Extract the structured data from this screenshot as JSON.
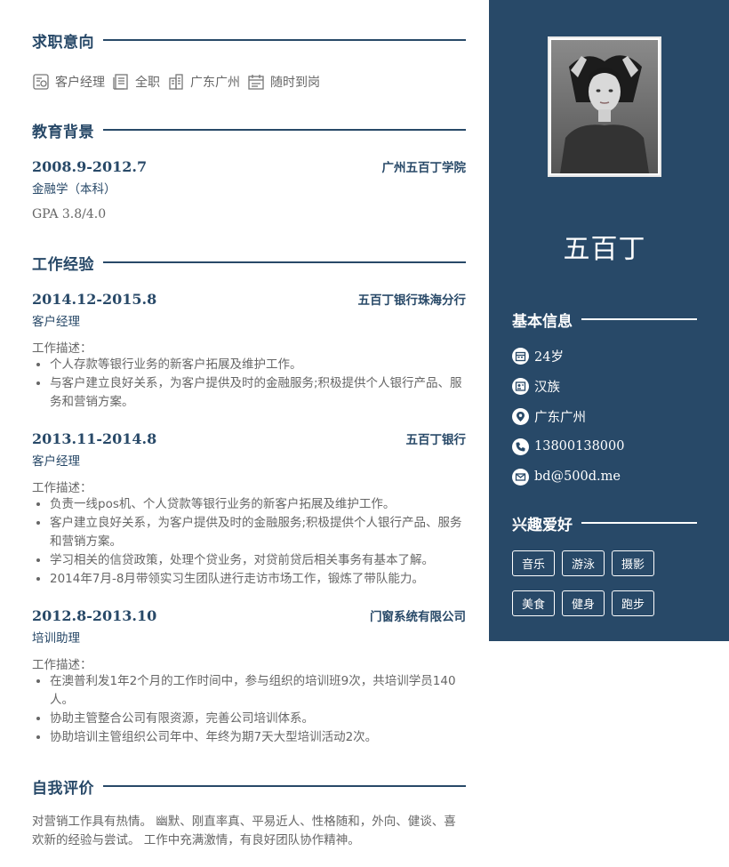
{
  "sections": {
    "intent": "求职意向",
    "education": "教育背景",
    "work": "工作经验",
    "self": "自我评价",
    "basic_info": "基本信息",
    "hobbies": "兴趣爱好"
  },
  "intent": {
    "position": "客户经理",
    "type": "全职",
    "city": "广东广州",
    "availability": "随时到岗"
  },
  "education": {
    "date": "2008.9-2012.7",
    "school": "广州五百丁学院",
    "major": "金融学（本科）",
    "gpa": "GPA 3.8/4.0"
  },
  "work": [
    {
      "date": "2014.12-2015.8",
      "company": "五百丁银行珠海分行",
      "role": "客户经理",
      "desc_label": "工作描述：",
      "bullets": [
        "个人存款等银行业务的新客户拓展及维护工作。",
        "与客户建立良好关系，为客户提供及时的金融服务;积极提供个人银行产品、服务和营销方案。"
      ]
    },
    {
      "date": "2013.11-2014.8",
      "company": "五百丁银行",
      "role": "客户经理",
      "desc_label": "工作描述：",
      "bullets": [
        "负责一线pos机、个人贷款等银行业务的新客户拓展及维护工作。",
        "客户建立良好关系，为客户提供及时的金融服务;积极提供个人银行产品、服务和营销方案。",
        "学习相关的信贷政策，处理个贷业务，对贷前贷后相关事务有基本了解。",
        "2014年7月-8月带领实习生团队进行走访市场工作，锻炼了带队能力。"
      ]
    },
    {
      "date": "2012.8-2013.10",
      "company": "门窗系统有限公司",
      "role": "培训助理",
      "desc_label": "工作描述：",
      "bullets": [
        "在澳普利发1年2个月的工作时间中，参与组织的培训班9次，共培训学员140人。",
        "协助主管整合公司有限资源，完善公司培训体系。",
        "协助培训主管组织公司年中、年终为期7天大型培训活动2次。"
      ]
    }
  ],
  "self_evaluation": "对营销工作具有热情。 幽默、刚直率真、平易近人、性格随和，外向、健谈、喜欢新的经验与尝试。 工作中充满激情，有良好团队协作精神。",
  "profile": {
    "name": "五百丁",
    "age": "24岁",
    "ethnicity": "汉族",
    "location": "广东广州",
    "phone": "13800138000",
    "email": "bd@500d.me"
  },
  "hobbies": [
    "音乐",
    "游泳",
    "摄影",
    "美食",
    "健身",
    "跑步"
  ],
  "colors": {
    "primary": "#284968",
    "text": "#666666",
    "white": "#ffffff"
  }
}
